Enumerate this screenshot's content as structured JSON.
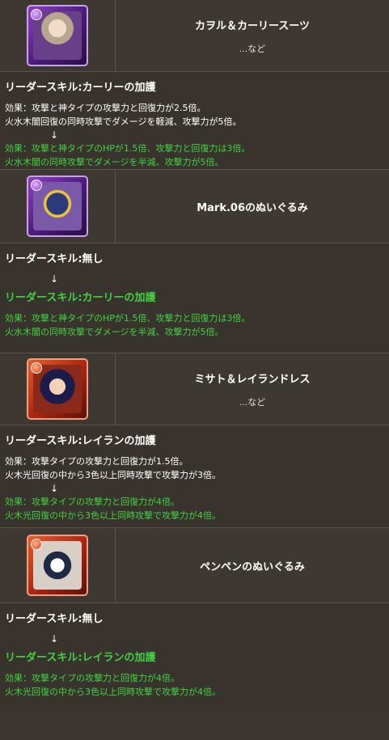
{
  "entries": [
    {
      "name": "カヲル＆カーリースーツ",
      "sub": "...など",
      "icon": "character-kaworu-icon",
      "attr": "dark",
      "skill_before": "リーダースキル:カーリーの加護",
      "effect_before": [
        "効果：攻撃と神タイプの攻撃力と回復力が2.5倍。",
        "火水木闇回復の同時攻撃でダメージを軽減、攻撃力が5倍。"
      ],
      "arrow": "↓",
      "effect_after": [
        "効果：攻撃と神タイプのHPが1.5倍、攻撃力と回復力は3倍。",
        "火水木闇の同時攻撃でダメージを半減、攻撃力が5倍。"
      ]
    },
    {
      "name": "Mark.06のぬいぐるみ",
      "icon": "mark06-plush-icon",
      "attr": "dark",
      "skill_before": "リーダースキル:無し",
      "arrow": "↓",
      "skill_after": "リーダースキル:カーリーの加護",
      "effect_after": [
        "効果：攻撃と神タイプのHPが1.5倍、攻撃力と回復力は3倍。",
        "火水木闇の同時攻撃でダメージを半減、攻撃力が5倍。"
      ]
    },
    {
      "name": "ミサト＆レイランドレス",
      "sub": "...など",
      "icon": "character-misato-icon",
      "attr": "fire",
      "skill_before": "リーダースキル:レイランの加護",
      "effect_before": [
        "効果：攻撃タイプの攻撃力と回復力が1.5倍。",
        "火木光回復の中から3色以上同時攻撃で攻撃力が3倍。"
      ],
      "arrow": "↓",
      "effect_after": [
        "効果：攻撃タイプの攻撃力と回復力が4倍。",
        "火木光回復の中から3色以上同時攻撃で攻撃力が4倍。"
      ]
    },
    {
      "name": "ペンペンのぬいぐるみ",
      "icon": "penpen-plush-icon",
      "attr": "fire",
      "skill_before": "リーダースキル:無し",
      "arrow": "↓",
      "skill_after": "リーダースキル:レイランの加護",
      "effect_after": [
        "効果：攻撃タイプの攻撃力と回復力が4倍。",
        "火木光回復の中から3色以上同時攻撃で攻撃力が4倍。"
      ]
    }
  ]
}
